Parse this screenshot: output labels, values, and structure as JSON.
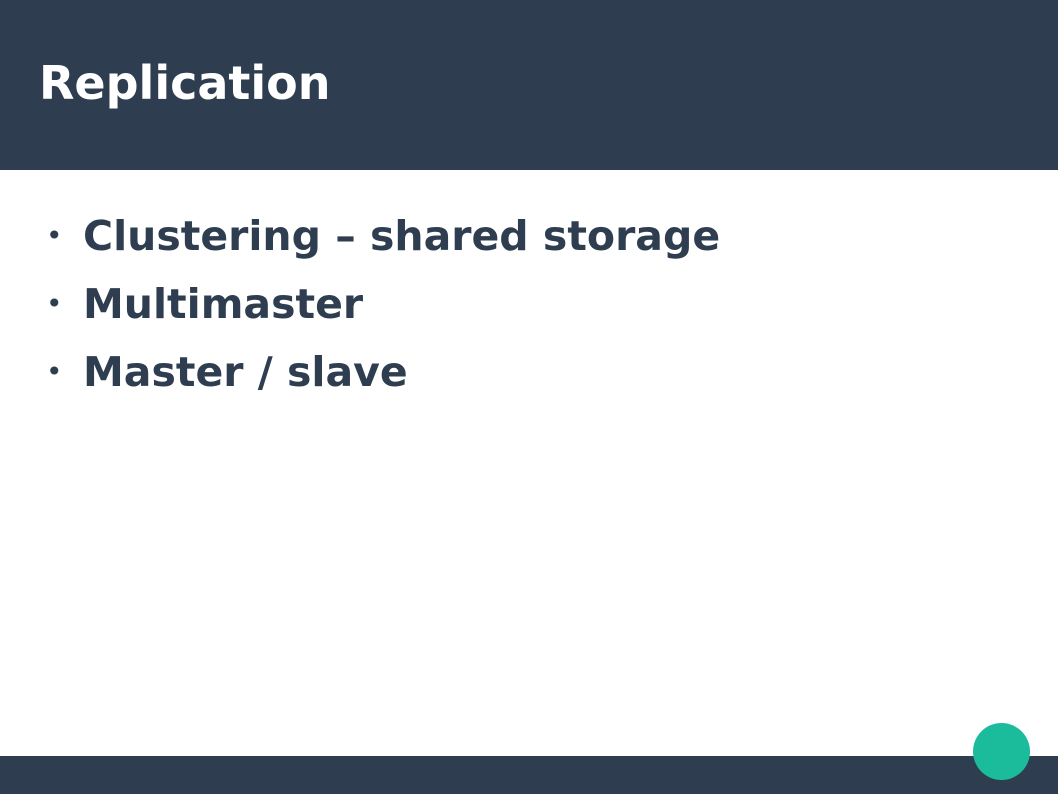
{
  "slide": {
    "title": "Replication",
    "bullets": [
      {
        "marker": "•",
        "text": "Clustering – shared storage"
      },
      {
        "marker": "•",
        "text": "Multimaster"
      },
      {
        "marker": "•",
        "text": "Master / slave"
      }
    ]
  },
  "colors": {
    "header_background": "#2e3e50",
    "body_text": "#2e3e50",
    "title_text": "#ffffff",
    "accent_circle": "#1abc9c",
    "background": "#ffffff"
  }
}
